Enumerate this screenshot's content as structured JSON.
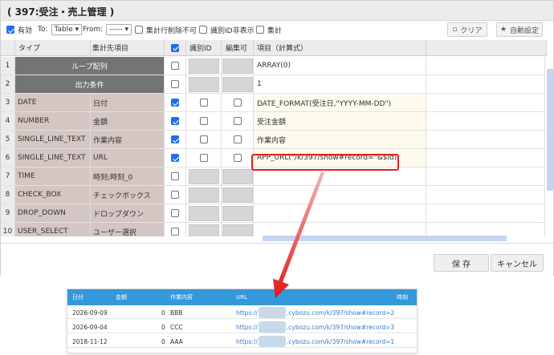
{
  "dialog": {
    "title": "( 397:受注・売上管理 )",
    "toolbar": {
      "enabled_label": "有効",
      "to_label": "To:",
      "to_value": "Table",
      "from_label": "From:",
      "from_value": "-----",
      "disable_delete_label": "集計行削除不可",
      "hide_id_label": "識別ID非表示",
      "aggregate_label": "集計",
      "clear_label": "クリア",
      "auto_setting_label": "自動設定"
    },
    "headers": {
      "type": "タイプ",
      "target": "集計先項目",
      "id": "識別ID",
      "editable": "編集可",
      "expr": "項目（計算式）"
    },
    "rows": [
      {
        "num": "1",
        "merged": "ループ配列",
        "expr": "ARRAY(0)"
      },
      {
        "num": "2",
        "merged": "出力条件",
        "expr": "1"
      },
      {
        "num": "3",
        "type": "DATE",
        "field": "日付",
        "expr": "DATE_FORMAT(受注日,\"YYYY-MM-DD\")"
      },
      {
        "num": "4",
        "type": "NUMBER",
        "field": "金額",
        "expr": "受注金額"
      },
      {
        "num": "5",
        "type": "SINGLE_LINE_TEXT",
        "field": "作業内容",
        "expr": "作業内容"
      },
      {
        "num": "6",
        "type": "SINGLE_LINE_TEXT",
        "field": "URL",
        "expr": "APP_URL(\"/k/397/show#record=\"&$id)"
      },
      {
        "num": "7",
        "type": "TIME",
        "field": "時刻;時刻_0",
        "expr": ""
      },
      {
        "num": "8",
        "type": "CHECK_BOX",
        "field": "チェックボックス",
        "expr": ""
      },
      {
        "num": "9",
        "type": "DROP_DOWN",
        "field": "ドロップダウン",
        "expr": ""
      },
      {
        "num": "10",
        "type": "USER_SELECT",
        "field": "ユーザー選択",
        "expr": ""
      }
    ],
    "save_label": "保 存",
    "cancel_label": "キャンセル"
  },
  "result_table": {
    "headers": {
      "date": "日付",
      "amount": "金額",
      "work": "作業内容",
      "url": "URL",
      "time": "時刻"
    },
    "rows": [
      {
        "date": "2026-09-09",
        "amount": "0",
        "work": "BBB",
        "url_prefix": "https://",
        "url_suffix": ".cybozu.com/k/397/show#record=2"
      },
      {
        "date": "2026-09-04",
        "amount": "0",
        "work": "CCC",
        "url_prefix": "https://",
        "url_suffix": ".cybozu.com/k/397/show#record=3"
      },
      {
        "date": "2018-11-12",
        "amount": "0",
        "work": "AAA",
        "url_prefix": "https://",
        "url_suffix": ".cybozu.com/k/397/show#record=1"
      }
    ]
  },
  "colors": {
    "accent_blue": "#1d6ff2",
    "row_type_bg": "#d4c6c2",
    "merged_bg": "#747474",
    "highlight_red": "#e02020",
    "result_header_blue": "#3498db"
  }
}
